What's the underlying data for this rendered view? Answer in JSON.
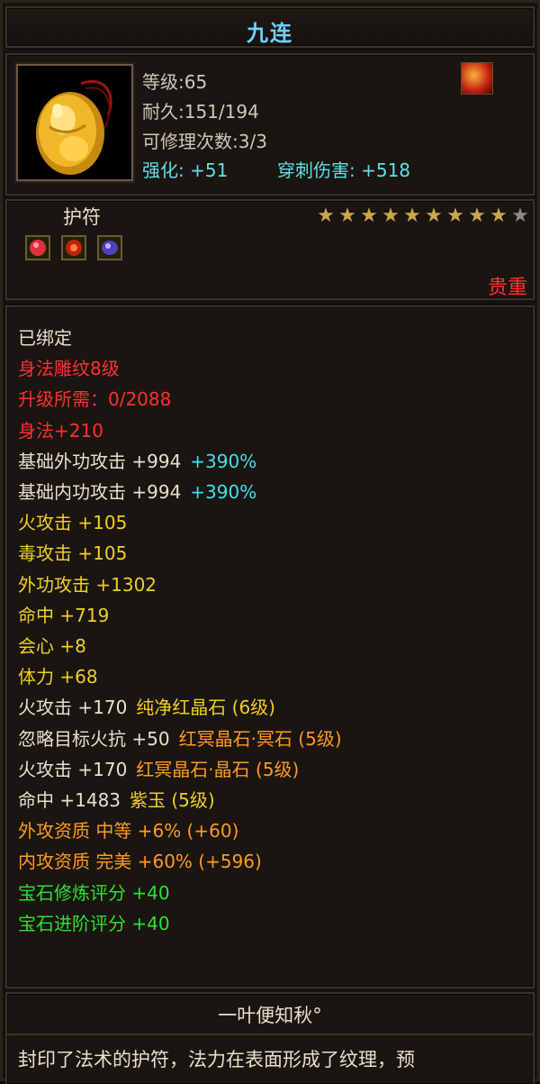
{
  "item": {
    "name": "九连",
    "level": "等级:65",
    "durability": "耐久:151/194",
    "repair_count": "可修理次数:3/3",
    "enhance": "强化: +51",
    "pierce_damage": "穿刺伤害: +518",
    "icon": "amber-talisman-icon",
    "corner_icon": "fire-buff-icon"
  },
  "type": {
    "label": "护符",
    "gems": [
      "red-gem-icon",
      "red-fire-gem-icon",
      "purple-gem-icon"
    ],
    "stars_filled": 9,
    "stars_total": 10,
    "rarity": "贵重"
  },
  "stats": [
    {
      "text": "已绑定",
      "color": "white"
    },
    {
      "text": "身法雕纹8级",
      "color": "red"
    },
    {
      "text": "升级所需：0/2088",
      "color": "red"
    },
    {
      "text": "身法+210",
      "color": "red"
    },
    {
      "text": "基础外功攻击 +994",
      "color": "white",
      "extra": "+390%",
      "extra_color": "cyan"
    },
    {
      "text": "基础内功攻击 +994",
      "color": "white",
      "extra": "+390%",
      "extra_color": "cyan"
    },
    {
      "text": "火攻击 +105",
      "color": "yellow"
    },
    {
      "text": "毒攻击 +105",
      "color": "yellow"
    },
    {
      "text": "外功攻击 +1302",
      "color": "yellow"
    },
    {
      "text": "命中 +719",
      "color": "yellow"
    },
    {
      "text": "会心 +8",
      "color": "yellow"
    },
    {
      "text": "体力 +68",
      "color": "yellow"
    },
    {
      "text": "火攻击 +170",
      "color": "white",
      "extra": "纯净红晶石 (6级)",
      "extra_color": "yellow"
    },
    {
      "text": "忽略目标火抗 +50",
      "color": "white",
      "extra": "红冥晶石·冥石 (5级)",
      "extra_color": "orange"
    },
    {
      "text": "火攻击 +170",
      "color": "white",
      "extra": "红冥晶石·晶石 (5级)",
      "extra_color": "orange"
    },
    {
      "text": "命中 +1483",
      "color": "white",
      "extra": "紫玉 (5级)",
      "extra_color": "yellow"
    },
    {
      "text": "外攻资质  中等 +6% (+60)",
      "color": "orange"
    },
    {
      "text": "内攻资质  完美 +60% (+596)",
      "color": "orange"
    },
    {
      "text": "宝石修炼评分 +40",
      "color": "green"
    },
    {
      "text": "宝石进阶评分 +40",
      "color": "green"
    }
  ],
  "footer": {
    "name": "一叶便知秋°",
    "description": "封印了法术的护符，法力在表面形成了纹理，预"
  },
  "colors": {
    "title": "#6fd0ff",
    "white": "#e8e0cc",
    "red": "#ff3030",
    "yellow": "#f0d020",
    "orange": "#ff9a20",
    "green": "#30e030",
    "cyan": "#40e0f0",
    "star_filled": "#c9a74a",
    "star_empty": "#8a8a8a"
  }
}
